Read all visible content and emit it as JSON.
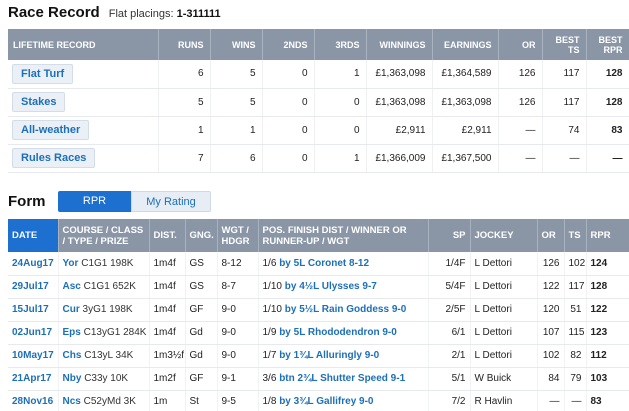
{
  "race_record": {
    "title": "Race Record",
    "flat_label": "Flat placings:",
    "flat_value": "1-311111"
  },
  "lifetime": {
    "headers": [
      "LIFETIME RECORD",
      "RUNS",
      "WINS",
      "2NDS",
      "3RDS",
      "WINNINGS",
      "EARNINGS",
      "OR",
      "BEST TS",
      "BEST RPR"
    ],
    "rows": [
      {
        "label": "Flat Turf",
        "runs": "6",
        "wins": "5",
        "seconds": "0",
        "thirds": "1",
        "winnings": "£1,363,098",
        "earnings": "£1,364,589",
        "or": "126",
        "best_ts": "117",
        "best_rpr": "128"
      },
      {
        "label": "Stakes",
        "runs": "5",
        "wins": "5",
        "seconds": "0",
        "thirds": "0",
        "winnings": "£1,363,098",
        "earnings": "£1,363,098",
        "or": "126",
        "best_ts": "117",
        "best_rpr": "128"
      },
      {
        "label": "All-weather",
        "runs": "1",
        "wins": "1",
        "seconds": "0",
        "thirds": "0",
        "winnings": "£2,911",
        "earnings": "£2,911",
        "or": "—",
        "best_ts": "74",
        "best_rpr": "83"
      },
      {
        "label": "Rules Races",
        "runs": "7",
        "wins": "6",
        "seconds": "0",
        "thirds": "1",
        "winnings": "£1,366,009",
        "earnings": "£1,367,500",
        "or": "—",
        "best_ts": "—",
        "best_rpr": "—"
      }
    ]
  },
  "form": {
    "title": "Form",
    "tabs": [
      "RPR",
      "My Rating"
    ],
    "headers": [
      "DATE",
      "COURSE / CLASS / TYPE / PRIZE",
      "DIST.",
      "GNG.",
      "WGT / HDGR",
      "POS. FINISH DIST / WINNER OR RUNNER-UP / WGT",
      "SP",
      "JOCKEY",
      "OR",
      "TS",
      "RPR"
    ],
    "rows": [
      {
        "date": "24Aug17",
        "course": "Yor",
        "cls": "C1G1 198K",
        "dist": "1m4f",
        "going": "GS",
        "wgt": "8-12",
        "pos": "1/6",
        "result": "by 5L Coronet 8-12",
        "sp": "1/4F",
        "jockey": "L Dettori",
        "or": "126",
        "ts": "102",
        "rpr": "124"
      },
      {
        "date": "29Jul17",
        "course": "Asc",
        "cls": "C1G1 652K",
        "dist": "1m4f",
        "going": "GS",
        "wgt": "8-7",
        "pos": "1/10",
        "result": "by 4½L Ulysses 9-7",
        "sp": "5/4F",
        "jockey": "L Dettori",
        "or": "122",
        "ts": "117",
        "rpr": "128"
      },
      {
        "date": "15Jul17",
        "course": "Cur",
        "cls": "3yG1 198K",
        "dist": "1m4f",
        "going": "GF",
        "wgt": "9-0",
        "pos": "1/10",
        "result": "by 5½L Rain Goddess 9-0",
        "sp": "2/5F",
        "jockey": "L Dettori",
        "or": "120",
        "ts": "51",
        "rpr": "122"
      },
      {
        "date": "02Jun17",
        "course": "Eps",
        "cls": "C13yG1 284K",
        "dist": "1m4f",
        "going": "Gd",
        "wgt": "9-0",
        "pos": "1/9",
        "result": "by 5L Rhododendron 9-0",
        "sp": "6/1",
        "jockey": "L Dettori",
        "or": "107",
        "ts": "115",
        "rpr": "123"
      },
      {
        "date": "10May17",
        "course": "Chs",
        "cls": "C13yL 34K",
        "dist": "1m3½f",
        "going": "Gd",
        "wgt": "9-0",
        "pos": "1/7",
        "result": "by 1¾L Alluringly 9-0",
        "sp": "2/1",
        "jockey": "L Dettori",
        "or": "102",
        "ts": "82",
        "rpr": "112"
      },
      {
        "date": "21Apr17",
        "course": "Nby",
        "cls": "C33y 10K",
        "dist": "1m2f",
        "going": "GF",
        "wgt": "9-1",
        "pos": "3/6",
        "result": "btn 2¾L Shutter Speed 9-1",
        "sp": "5/1",
        "jockey": "W Buick",
        "or": "84",
        "ts": "79",
        "rpr": "103"
      },
      {
        "date": "28Nov16",
        "course": "Ncs",
        "cls": "C52yMd 3K",
        "dist": "1m",
        "going": "St",
        "wgt": "9-5",
        "pos": "1/8",
        "result": "by 3¾L Gallifrey 9-0",
        "sp": "7/2",
        "jockey": "R Havlin",
        "or": "—",
        "ts": "—",
        "rpr": "83"
      }
    ]
  },
  "colors": {
    "header_bg": "#8a96a6",
    "accent": "#1d6fd0",
    "link": "#1d6fb8"
  }
}
